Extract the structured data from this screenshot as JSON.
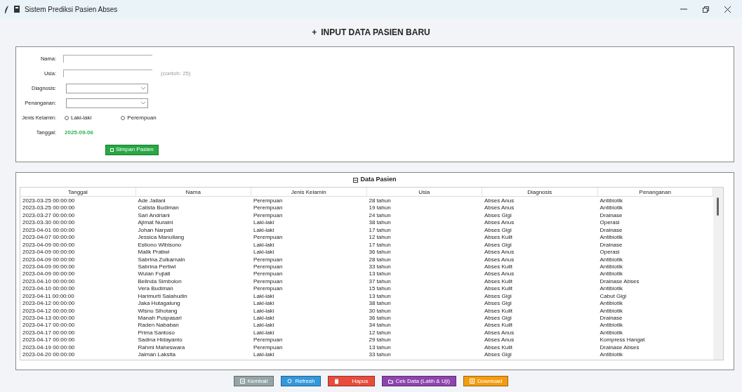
{
  "window": {
    "title": "Sistem Prediksi Pasien Abses"
  },
  "heading": {
    "icon": "+",
    "text": "INPUT DATA PASIEN BARU"
  },
  "form": {
    "fields": [
      {
        "kind": "text",
        "label": "Nama:"
      },
      {
        "kind": "text",
        "label": "Usia:",
        "hint": "(contoh: 25)"
      },
      {
        "kind": "select",
        "label": "Diagnosis:"
      },
      {
        "kind": "select",
        "label": "Penanganan:"
      },
      {
        "kind": "radio",
        "label": "Jenis Kelamin:",
        "options": [
          {
            "label": "Laki-laki",
            "selected": false
          },
          {
            "label": "Perempuan",
            "selected": false
          }
        ]
      },
      {
        "kind": "date",
        "label": "Tanggal:",
        "value": "2025-09-06"
      }
    ],
    "save_button": "Simpan Pasien"
  },
  "table": {
    "title": "Data Pasien",
    "columns": [
      "Tanggal",
      "Nama",
      "Jenis Kelamin",
      "Usia",
      "Diagnosis",
      "Penanganan"
    ],
    "rows": [
      [
        "2023-03-25 00:00:00",
        "Ade Jailani",
        "Perempuan",
        "28 tahun",
        "Abses Anus",
        "Antibiotik"
      ],
      [
        "2023-03-25 00:00:00",
        "Calista Budiman",
        "Perempuan",
        "19 tahun",
        "Abses Anus",
        "Antibiotik"
      ],
      [
        "2023-03-27 00:00:00",
        "Sari Andriani",
        "Perempuan",
        "24 tahun",
        "Abses Gigi",
        "Drainase"
      ],
      [
        "2023-03-30 00:00:00",
        "Ajimat Nuraini",
        "Laki-laki",
        "38 tahun",
        "Abses Anus",
        "Operasi"
      ],
      [
        "2023-04-01 00:00:00",
        "Johan Narpati",
        "Laki-laki",
        "17 tahun",
        "Abses Gigi",
        "Drainase"
      ],
      [
        "2023-04-07 00:00:00",
        "Jessica Manullang",
        "Perempuan",
        "12 tahun",
        "Abses Kulit",
        "Antibiotik"
      ],
      [
        "2023-04-09 00:00:00",
        "Estiono Wibisono",
        "Laki-laki",
        "17 tahun",
        "Abses Gigi",
        "Drainase"
      ],
      [
        "2023-04-09 00:00:00",
        "Malik Pratiwi",
        "Laki-laki",
        "36 tahun",
        "Abses Anus",
        "Operasi"
      ],
      [
        "2023-04-09 00:00:00",
        "Sabrina Zulkarnain",
        "Perempuan",
        "28 tahun",
        "Abses Anus",
        "Antibiotik"
      ],
      [
        "2023-04-09 00:00:00",
        "Sabrina Pertiwi",
        "Perempuan",
        "33 tahun",
        "Abses Kulit",
        "Antibiotik"
      ],
      [
        "2023-04-09 00:00:00",
        "Wulan Fujiati",
        "Perempuan",
        "13 tahun",
        "Abses Anus",
        "Antibiotik"
      ],
      [
        "2023-04-10 00:00:00",
        "Belinda Simbolon",
        "Perempuan",
        "37 tahun",
        "Abses Kulit",
        "Drainase Abses"
      ],
      [
        "2023-04-10 00:00:00",
        "Vera Budiman",
        "Perempuan",
        "15 tahun",
        "Abses Kulit",
        "Antibiotik"
      ],
      [
        "2023-04-11 00:00:00",
        "Harimurti Salahudin",
        "Laki-laki",
        "13 tahun",
        "Abses Gigi",
        "Cabut Gigi"
      ],
      [
        "2023-04-12 00:00:00",
        "Jaka Hutagalung",
        "Laki-laki",
        "38 tahun",
        "Abses Gigi",
        "Antibiotik"
      ],
      [
        "2023-04-12 00:00:00",
        "Wisnu Sihotang",
        "Laki-laki",
        "30 tahun",
        "Abses Kulit",
        "Antibiotik"
      ],
      [
        "2023-04-13 00:00:00",
        "Manah Puspasari",
        "Laki-laki",
        "36 tahun",
        "Abses Gigi",
        "Drainase"
      ],
      [
        "2023-04-17 00:00:00",
        "Raden Nababan",
        "Laki-laki",
        "34 tahun",
        "Abses Kulit",
        "Antibiotik"
      ],
      [
        "2023-04-17 00:00:00",
        "Prima Santoso",
        "Laki-laki",
        "12 tahun",
        "Abses Anus",
        "Antibiotik"
      ],
      [
        "2023-04-17 00:00:00",
        "Sadina Hidayanto",
        "Perempuan",
        "29 tahun",
        "Abses Anus",
        "Kompress Hangat"
      ],
      [
        "2023-04-19 00:00:00",
        "Rahmi Maheswara",
        "Perempuan",
        "13 tahun",
        "Abses Kulit",
        "Drainase Abses"
      ],
      [
        "2023-04-20 00:00:00",
        "Jaiman Laksita",
        "Laki-laki",
        "33 tahun",
        "Abses Gigi",
        "Antibiotik"
      ]
    ]
  },
  "buttons": [
    {
      "kind": "back",
      "label": "Kembali",
      "color": "#95a5a6"
    },
    {
      "kind": "refresh",
      "label": "Refresh",
      "color": "#3498db"
    },
    {
      "kind": "delete",
      "label": "Hapus",
      "color": "#e74c3c"
    },
    {
      "kind": "check",
      "label": "Cek Data (Latih & Uji)",
      "color": "#8e44ad"
    },
    {
      "kind": "download",
      "label": "Download",
      "color": "#f39c12"
    }
  ]
}
